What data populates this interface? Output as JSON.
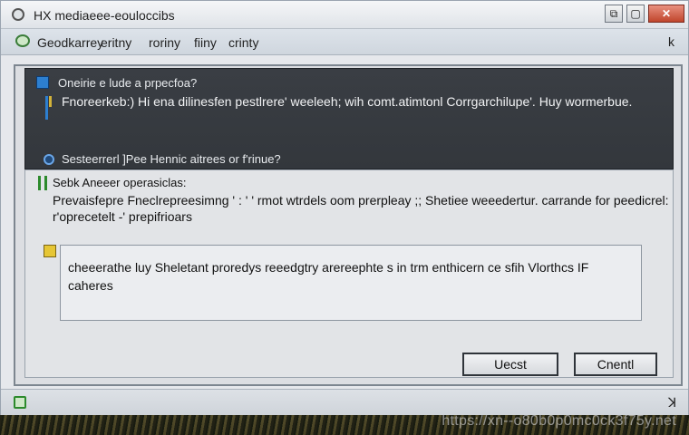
{
  "window": {
    "title": "HX   mediaeee-eouloccibs",
    "min_label": "⧉",
    "max_label": "▢",
    "close_label": "✕"
  },
  "menu": {
    "items": [
      "Geodkarrey",
      "eritny",
      "roriny",
      "fiiny",
      "crinty"
    ],
    "help_label": "k"
  },
  "dark_panel": {
    "heading": "Oneirie e lude a prpecfoa?",
    "description": "Fnoreerkeb:) Hi ena dilinesfen pestlrere' weeleeh; wih comt.atimtonl Corrgarchilupe'.  Huy wormerbue.",
    "option_label": "Sesteerrerl ]Pee Hennic aitrees or f'rinue?"
  },
  "section": {
    "title": "Sebk Aneeer operasiclas:",
    "description": "Prevaisfepre Fneclrepreesimng ' :  '  ' rmot wtrdels oom prerpleay ;; Shetiee weeedertur. carrande for peedicrel: r'oprecetelt -' prepifrioars"
  },
  "notice": {
    "text": "cheeerathe luy Sheletant proredys reeedgtry arereephte s in trm enthicern ce sfih Vlorthcs IF caheres"
  },
  "buttons": {
    "cancel": "Uecst",
    "create": "Cnentl"
  },
  "statusbar": {
    "resize_label": "ꓘ"
  },
  "watermark": "https://xn--o80b0p0mc0ck3f75y.net"
}
